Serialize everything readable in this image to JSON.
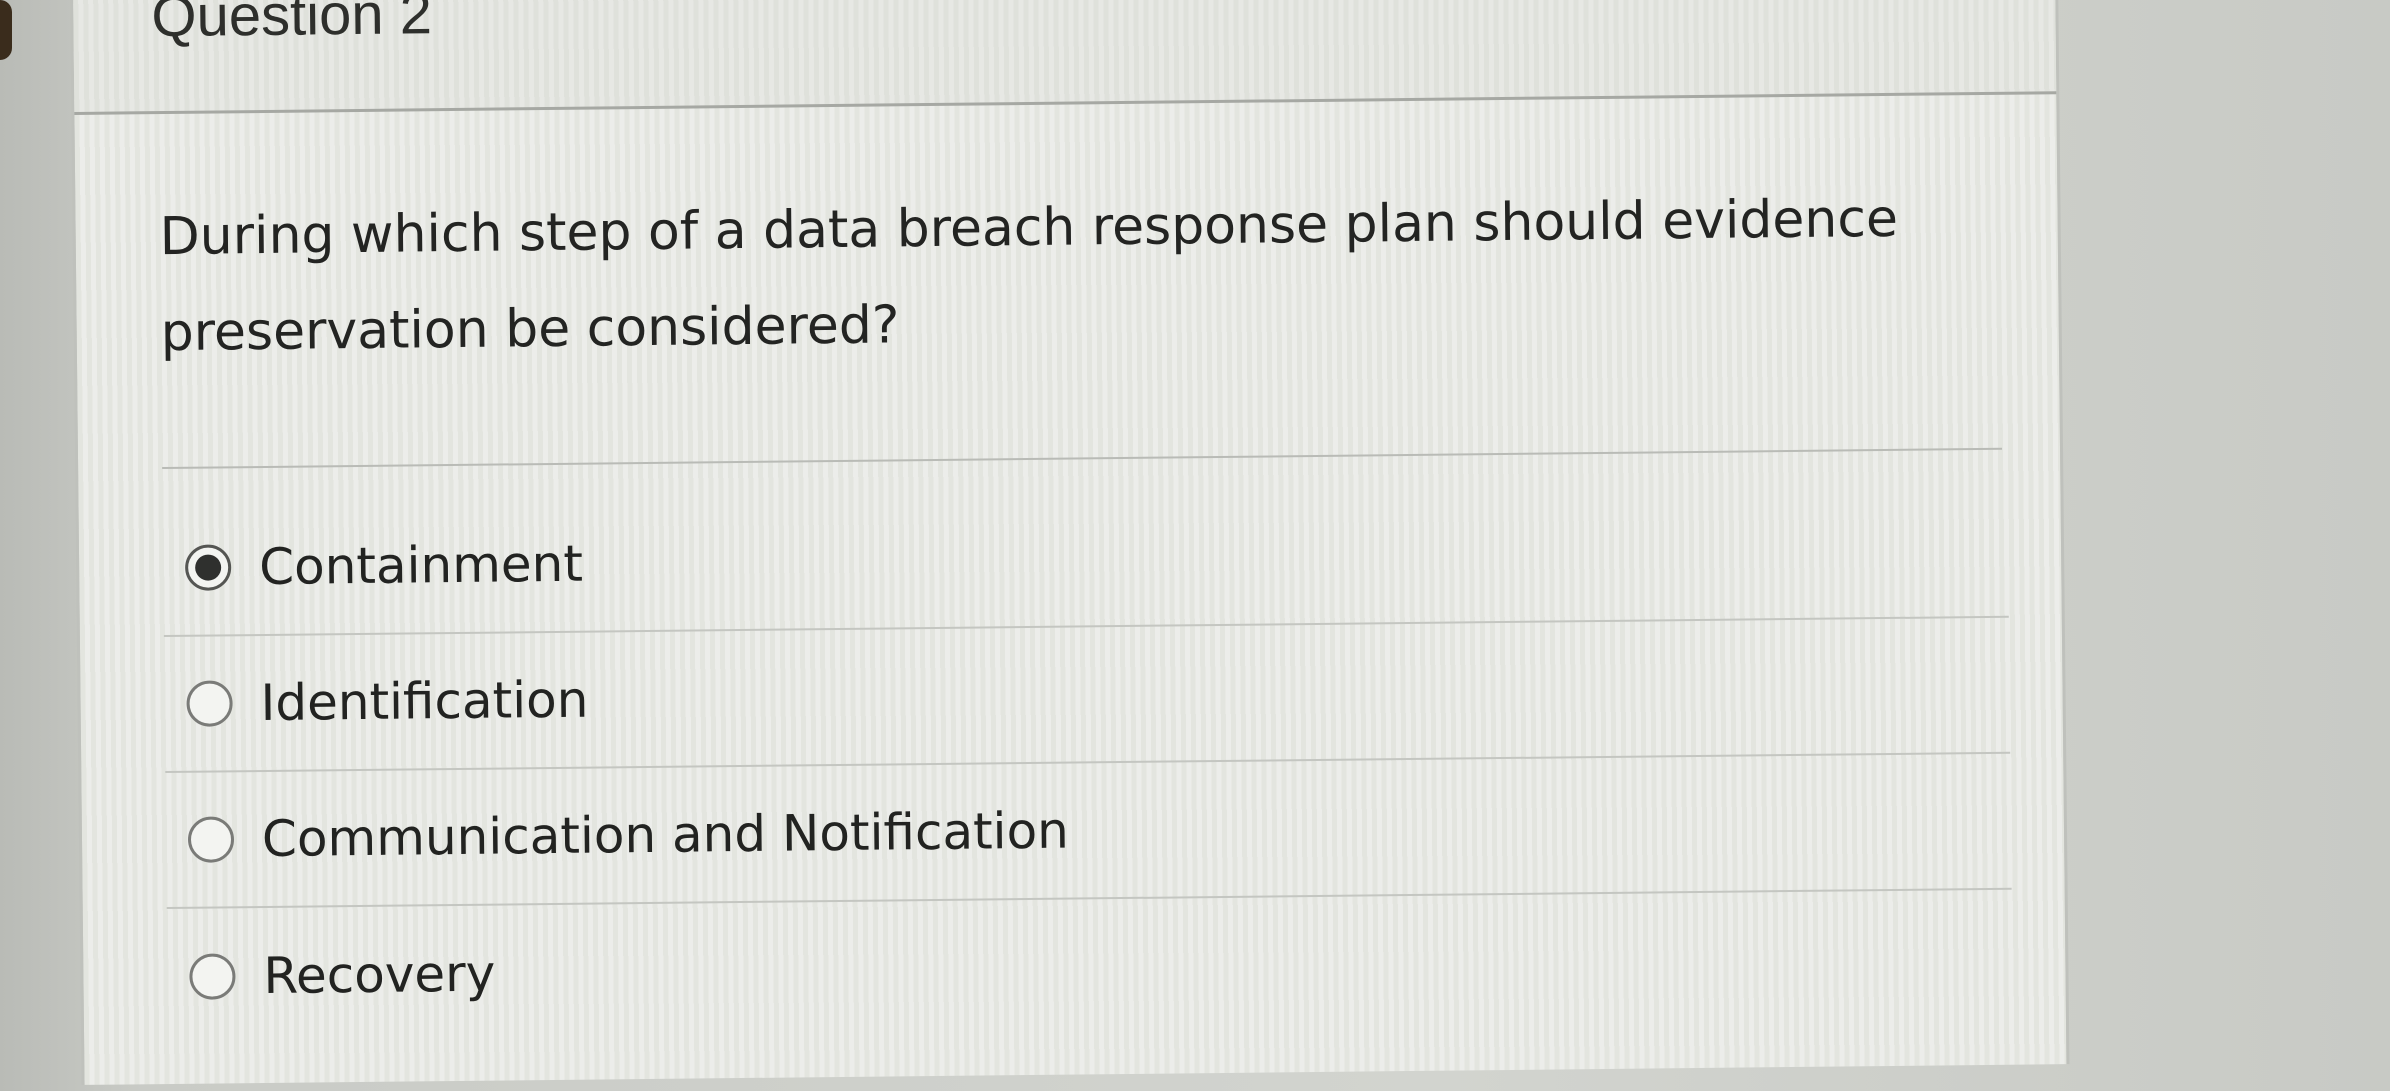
{
  "question": {
    "title": "Question 2",
    "text": "During which step of a data breach response plan should evidence preservation be considered?",
    "options": [
      {
        "label": "Containment",
        "selected": true
      },
      {
        "label": "Identification",
        "selected": false
      },
      {
        "label": "Communication and Notification",
        "selected": false
      },
      {
        "label": "Recovery",
        "selected": false
      }
    ]
  },
  "colors": {
    "background": "#d2d4cf",
    "card": "#e7e8e4",
    "text": "#232422",
    "radio_selected": "#2f302e"
  }
}
